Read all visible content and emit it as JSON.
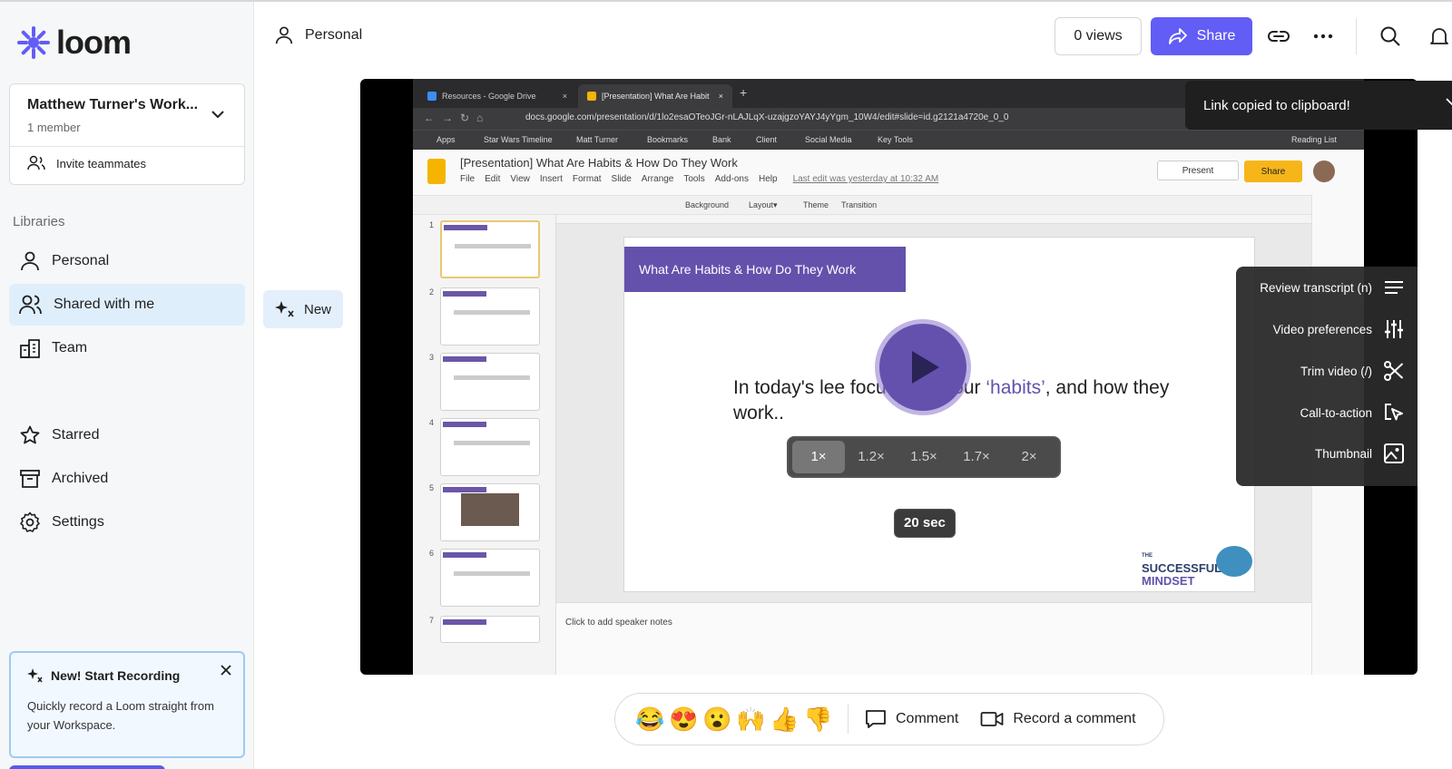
{
  "brand": {
    "name": "loom",
    "color": "#625df5"
  },
  "workspace": {
    "name": "Matthew Turner's Work...",
    "members": "1 member",
    "invite_label": "Invite teammates"
  },
  "sidebar": {
    "libraries_heading": "Libraries",
    "items": [
      {
        "label": "Personal",
        "icon": "person-icon"
      },
      {
        "label": "Shared with me",
        "icon": "people-icon",
        "active": true
      },
      {
        "label": "Team",
        "icon": "building-icon"
      },
      {
        "label": "Starred",
        "icon": "star-icon"
      },
      {
        "label": "Archived",
        "icon": "archive-icon"
      },
      {
        "label": "Settings",
        "icon": "gear-icon"
      }
    ]
  },
  "promo": {
    "title": "New! Start Recording",
    "body": "Quickly record a Loom straight from your Workspace."
  },
  "header": {
    "breadcrumb": "Personal",
    "views": "0 views",
    "share_label": "Share"
  },
  "new_chip": "New",
  "toast": "Link copied to clipboard!",
  "video_menu": [
    {
      "label": "Review transcript (n)",
      "icon": "lines-icon"
    },
    {
      "label": "Video preferences",
      "icon": "sliders-icon"
    },
    {
      "label": "Trim video (/)",
      "icon": "scissors-icon"
    },
    {
      "label": "Call-to-action",
      "icon": "cursor-click-icon"
    },
    {
      "label": "Thumbnail",
      "icon": "image-icon"
    }
  ],
  "playback": {
    "speeds": [
      "1×",
      "1.2×",
      "1.5×",
      "1.7×",
      "2×"
    ],
    "selected": "1×",
    "duration_badge": "20 sec"
  },
  "screen": {
    "tabs": [
      "Resources - Google Drive",
      "[Presentation] What Are Habit"
    ],
    "url": "docs.google.com/presentation/d/1lo2esaOTeoJGr-nLAJLqX-uzajgzoYAYJ4yYgm_10W4/edit#slide=id.g2121a4720e_0_0",
    "bookmarks": [
      "Apps",
      "Star Wars Timeline",
      "Matt Turner",
      "Bookmarks",
      "Bank",
      "Client",
      "Social Media",
      "Key Tools",
      "Reading List"
    ],
    "doc_title": "[Presentation] What Are Habits & How Do They Work",
    "menu": [
      "File",
      "Edit",
      "View",
      "Insert",
      "Format",
      "Slide",
      "Arrange",
      "Tools",
      "Add-ons",
      "Help"
    ],
    "last_edit": "Last edit was yesterday at 10:32 AM",
    "present_label": "Present",
    "share_label": "Share",
    "toolbar": [
      "Background",
      "Layout▾",
      "Theme",
      "Transition"
    ],
    "slide_numbers": [
      "1",
      "2",
      "3",
      "4",
      "5",
      "6",
      "7"
    ],
    "slide_title": "What Are Habits & How Do They Work",
    "slide_text_pre": "In today's le",
    "slide_text_mid": "e focus onto your ",
    "slide_text_hl": "‘habits’",
    "slide_text_post": ", and how they work..",
    "brand_small": "THE",
    "brand_line1": "SUCCESSFUL",
    "brand_line2": "MINDSET",
    "notes_placeholder": "Click to add speaker notes"
  },
  "reactions": {
    "emojis": [
      "😂",
      "😍",
      "😮",
      "🙌",
      "👍",
      "👎"
    ],
    "comment_label": "Comment",
    "record_label": "Record a comment"
  }
}
